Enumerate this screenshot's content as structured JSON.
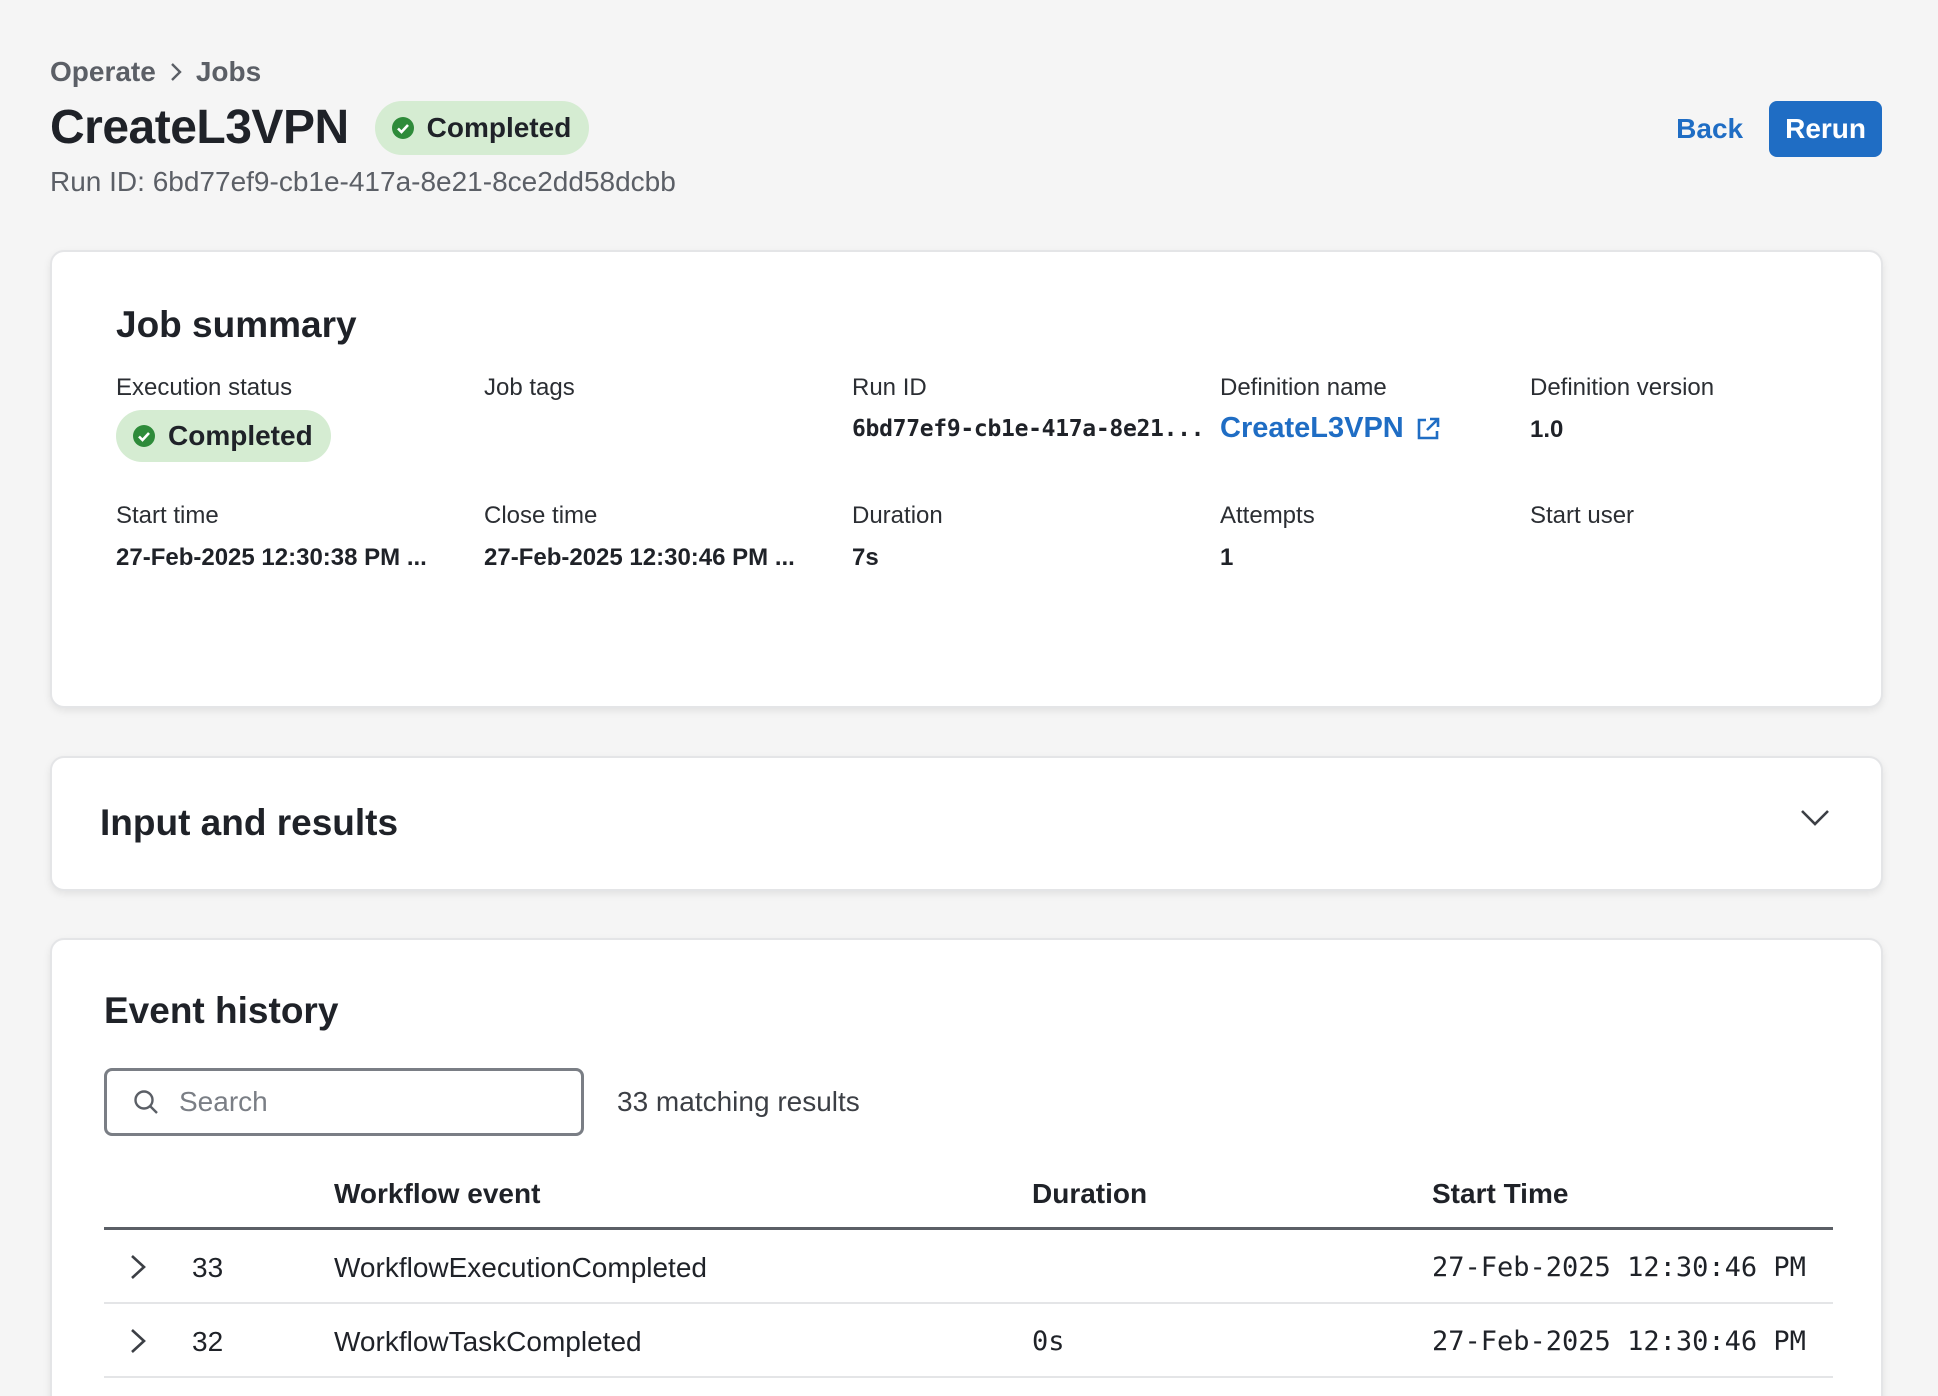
{
  "breadcrumb": {
    "items": [
      "Operate",
      "Jobs"
    ]
  },
  "header": {
    "title": "CreateL3VPN",
    "status": "Completed",
    "run_id_line": "Run ID: 6bd77ef9-cb1e-417a-8e21-8ce2dd58dcbb",
    "back_label": "Back",
    "rerun_label": "Rerun"
  },
  "summary": {
    "title": "Job summary",
    "execution_status_label": "Execution status",
    "execution_status": "Completed",
    "job_tags_label": "Job tags",
    "run_id_label": "Run ID",
    "run_id": "6bd77ef9-cb1e-417a-8e21...",
    "definition_name_label": "Definition name",
    "definition_name": "CreateL3VPN",
    "definition_version_label": "Definition version",
    "definition_version": "1.0",
    "start_time_label": "Start time",
    "start_time": "27-Feb-2025 12:30:38 PM ...",
    "close_time_label": "Close time",
    "close_time": "27-Feb-2025 12:30:46 PM ...",
    "duration_label": "Duration",
    "duration": "7s",
    "attempts_label": "Attempts",
    "attempts": "1",
    "start_user_label": "Start user"
  },
  "input_results": {
    "title": "Input and results"
  },
  "events": {
    "title": "Event history",
    "search_placeholder": "Search",
    "match_count": "33 matching results",
    "columns": {
      "event": "Workflow event",
      "duration": "Duration",
      "start_time": "Start Time"
    },
    "rows": [
      {
        "id": "33",
        "event": "WorkflowExecutionCompleted",
        "duration": "",
        "start_time": "27-Feb-2025 12:30:46 PM"
      },
      {
        "id": "32",
        "event": "WorkflowTaskCompleted",
        "duration": "0s",
        "start_time": "27-Feb-2025 12:30:46 PM"
      }
    ]
  },
  "colors": {
    "accent": "#1f6dc4",
    "success_bg": "#d5ecd2",
    "success_icon": "#2e8b3a",
    "page_bg": "#f5f5f5"
  }
}
